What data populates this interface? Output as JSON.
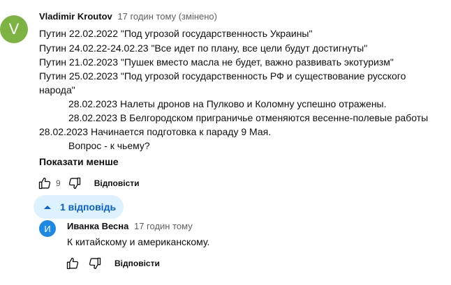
{
  "comment": {
    "avatar_letter": "V",
    "avatar_color": "#7cb342",
    "author": "Vladimir Kroutov",
    "time": "17 годин тому (змінено)",
    "lines": [
      "Путин 22.02.2022 \"Под угрозой государственность Украины\"",
      "Путин 24.02.22-24.02.23 \"Все идет по плану, все цели будут достигнуты\"",
      "Путин 21.02.2023 \"Пушек вместо масла не будет, важно развивать экотуризм\"",
      "Путин 25.02.2023 \"Под угрозой государственность РФ и существование русского",
      "народа\"",
      "28.02.2023 Налеты дронов на Пулково и Коломну успешно отражены.",
      "28.02.2023 В Белгородском приграничье отменяются весенне-полевые работы",
      "28.02.2023 Начинается подготовка к параду 9 Мая.",
      "Вопрос - к чьему?"
    ],
    "show_less": "Показати менше",
    "like_count": "9",
    "reply_label": "Відповісти",
    "like_icon": "thumb-up-icon",
    "dislike_icon": "thumb-down-icon"
  },
  "replies_toggle": {
    "label": "1 відповідь",
    "icon": "chevron-up-icon",
    "bg_color": "#def1ff",
    "text_color": "#065fd4"
  },
  "reply": {
    "avatar_letter": "И",
    "avatar_color": "#1e88e5",
    "author": "Иванка Весна",
    "time": "17 годин тому",
    "text": "К китайскому и американскому.",
    "reply_label": "Відповісти"
  }
}
